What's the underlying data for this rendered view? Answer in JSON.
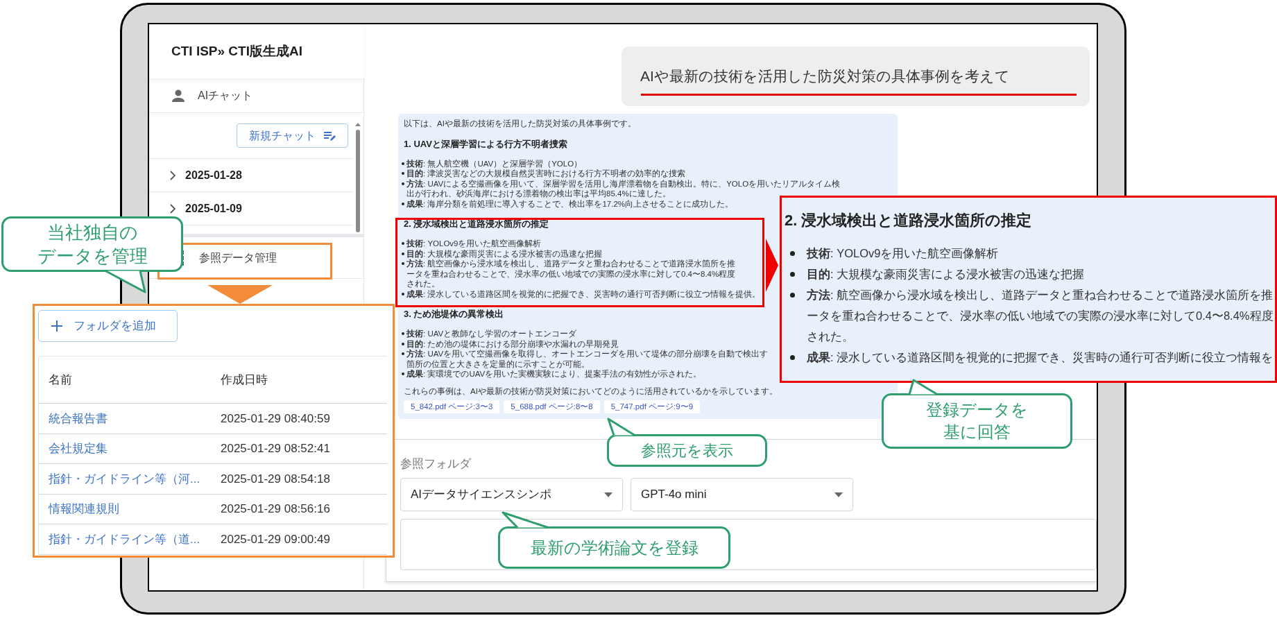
{
  "app_title": "CTI ISP» CTI版生成AI",
  "sidebar": {
    "chat_label": "AIチャット",
    "new_chat_button": "新規チャット",
    "history": [
      {
        "label": "2025-01-28",
        "expanded": false
      },
      {
        "label": "2025-01-09",
        "expanded": false
      }
    ],
    "data_menu_label": "参照データ管理"
  },
  "user_message": "AIや最新の技術を活用した防災対策の具体事例を考えて",
  "answer": {
    "intro": "以下は、AIや最新の技術を活用した防災対策の具体事例です。",
    "sections": [
      {
        "heading": "1. UAVと深層学習による行方不明者捜索",
        "items": [
          {
            "lines": [
              "**技術**: 無人航空機（UAV）と深層学習（YOLO）"
            ]
          },
          {
            "lines": [
              "**目的**: 津波災害などの大規模自然災害時における行方不明者の効率的な捜索"
            ]
          },
          {
            "lines": [
              "**方法**: UAVによる空撮画像を用いて、深層学習を活用し海岸漂着物を自動検出。特に、YOLOを用いたリアルタイム検",
              "出が行われ、砂浜海岸における漂着物の検出率は平均85.4%に達した。"
            ]
          },
          {
            "lines": [
              "**成果**: 海岸分類を前処理に導入することで、検出率を17.2%向上させることに成功した。"
            ]
          }
        ]
      },
      {
        "heading": "2. 浸水域検出と道路浸水箇所の推定",
        "items": [
          {
            "lines": [
              "**技術**: YOLOv9を用いた航空画像解析"
            ]
          },
          {
            "lines": [
              "**目的**: 大規模な豪雨災害による浸水被害の迅速な把握"
            ]
          },
          {
            "lines": [
              "**方法**: 航空画像から浸水域を検出し、道路データと重ね合わせることで道路浸水箇所を推",
              "ータを重ね合わせることで、浸水率の低い地域での実際の浸水率に対して0.4〜8.4%程度",
              "された。"
            ]
          },
          {
            "lines": [
              "**成果**: 浸水している道路区間を視覚的に把握でき、災害時の通行可否判断に役立つ情報を提供。"
            ]
          }
        ]
      },
      {
        "heading": "3. ため池堤体の異常検出",
        "items": [
          {
            "lines": [
              "**技術**: UAVと教師なし学習のオートエンコーダ"
            ]
          },
          {
            "lines": [
              "**目的**: ため池の堤体における部分崩壊や水漏れの早期発見"
            ]
          },
          {
            "lines": [
              "**方法**: UAVを用いて空撮画像を取得し、オートエンコーダを用いて堤体の部分崩壊を自動で検出す",
              "箇所の位置と大きさを定量的に示すことが可能。"
            ]
          },
          {
            "lines": [
              "**成果**: 実環境でのUAVを用いた実機実験により、提案手法の有効性が示された。"
            ]
          }
        ]
      }
    ],
    "closing": "これらの事例は、AIや最新の技術が防災対策においてどのように活用されているかを示しています。",
    "sources": [
      "5_842.pdf ページ:3〜3",
      "5_688.pdf ページ:8〜8",
      "5_747.pdf ページ:9〜9"
    ]
  },
  "zoom_view": {
    "heading": "2. 浸水域検出と道路浸水箇所の推定",
    "items": [
      {
        "lines": [
          "**技術**: YOLOv9を用いた航空画像解析"
        ]
      },
      {
        "lines": [
          "**目的**: 大規模な豪雨災害による浸水被害の迅速な把握"
        ]
      },
      {
        "lines": [
          "**方法**: 航空画像から浸水域を検出し、道路データと重ね合わせることで道路浸水箇所を推",
          "ータを重ね合わせることで、浸水率の低い地域での実際の浸水率に対して0.4〜8.4%程度",
          "された。"
        ]
      },
      {
        "lines": [
          "**成果**: 浸水している道路区間を視覚的に把握でき、災害時の通行可否判断に役立つ情報を"
        ]
      }
    ]
  },
  "form": {
    "folder_label": "参照フォルダ",
    "folder_value": "AIデータサイエンスシンポ",
    "model_value": "GPT-4o mini"
  },
  "folder_panel": {
    "add_button": "フォルダを追加",
    "columns": [
      "名前",
      "作成日時"
    ],
    "rows": [
      [
        "統合報告書",
        "2025-01-29 08:40:59"
      ],
      [
        "会社規定集",
        "2025-01-29 08:52:41"
      ],
      [
        "指針・ガイドライン等（河...",
        "2025-01-29 08:54:18"
      ],
      [
        "情報関連規則",
        "2025-01-29 08:56:16"
      ],
      [
        "指針・ガイドライン等（道...",
        "2025-01-29 09:00:49"
      ]
    ]
  },
  "callouts": [
    {
      "lines": [
        "当社独自の",
        "データを管理"
      ]
    },
    {
      "lines": [
        "参照元を表示"
      ]
    },
    {
      "lines": [
        "最新の学術論文を登録"
      ]
    },
    {
      "lines": [
        "登録データを",
        "基に回答"
      ]
    }
  ]
}
